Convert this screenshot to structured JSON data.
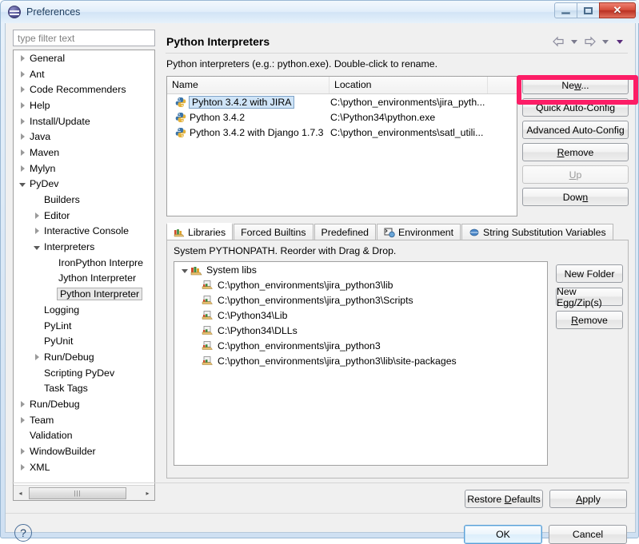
{
  "window": {
    "title": "Preferences",
    "icon": "preferences-icon",
    "controls": {
      "minimize": "–",
      "maximize": "□",
      "close": "✕"
    }
  },
  "sidebar": {
    "filter_placeholder": "type filter text",
    "items": [
      {
        "label": "General",
        "indent": 0,
        "twisty": "collapsed",
        "selected": false
      },
      {
        "label": "Ant",
        "indent": 0,
        "twisty": "collapsed",
        "selected": false
      },
      {
        "label": "Code Recommenders",
        "indent": 0,
        "twisty": "collapsed",
        "selected": false
      },
      {
        "label": "Help",
        "indent": 0,
        "twisty": "collapsed",
        "selected": false
      },
      {
        "label": "Install/Update",
        "indent": 0,
        "twisty": "collapsed",
        "selected": false
      },
      {
        "label": "Java",
        "indent": 0,
        "twisty": "collapsed",
        "selected": false
      },
      {
        "label": "Maven",
        "indent": 0,
        "twisty": "collapsed",
        "selected": false
      },
      {
        "label": "Mylyn",
        "indent": 0,
        "twisty": "collapsed",
        "selected": false
      },
      {
        "label": "PyDev",
        "indent": 0,
        "twisty": "expanded",
        "selected": false
      },
      {
        "label": "Builders",
        "indent": 1,
        "twisty": "none",
        "selected": false
      },
      {
        "label": "Editor",
        "indent": 1,
        "twisty": "collapsed",
        "selected": false
      },
      {
        "label": "Interactive Console",
        "indent": 1,
        "twisty": "collapsed",
        "selected": false
      },
      {
        "label": "Interpreters",
        "indent": 1,
        "twisty": "expanded",
        "selected": false
      },
      {
        "label": "IronPython Interpre",
        "indent": 2,
        "twisty": "none",
        "selected": false
      },
      {
        "label": "Jython Interpreter",
        "indent": 2,
        "twisty": "none",
        "selected": false
      },
      {
        "label": "Python Interpreter",
        "indent": 2,
        "twisty": "none",
        "selected": true
      },
      {
        "label": "Logging",
        "indent": 1,
        "twisty": "none",
        "selected": false
      },
      {
        "label": "PyLint",
        "indent": 1,
        "twisty": "none",
        "selected": false
      },
      {
        "label": "PyUnit",
        "indent": 1,
        "twisty": "none",
        "selected": false
      },
      {
        "label": "Run/Debug",
        "indent": 1,
        "twisty": "collapsed",
        "selected": false
      },
      {
        "label": "Scripting PyDev",
        "indent": 1,
        "twisty": "none",
        "selected": false
      },
      {
        "label": "Task Tags",
        "indent": 1,
        "twisty": "none",
        "selected": false
      },
      {
        "label": "Run/Debug",
        "indent": 0,
        "twisty": "collapsed",
        "selected": false
      },
      {
        "label": "Team",
        "indent": 0,
        "twisty": "collapsed",
        "selected": false
      },
      {
        "label": "Validation",
        "indent": 0,
        "twisty": "none",
        "selected": false
      },
      {
        "label": "WindowBuilder",
        "indent": 0,
        "twisty": "collapsed",
        "selected": false
      },
      {
        "label": "XML",
        "indent": 0,
        "twisty": "collapsed",
        "selected": false
      }
    ],
    "hscroll": {
      "left_arrow": "◂",
      "right_arrow": "▸",
      "grip": "|||"
    }
  },
  "main": {
    "page_title": "Python Interpreters",
    "description": "Python interpreters (e.g.: python.exe).  Double-click to rename.",
    "nav": {
      "back": "back-arrow",
      "back_menu": "chevron-down",
      "forward": "forward-arrow",
      "forward_menu": "chevron-down",
      "view_menu": "chevron-down"
    },
    "table": {
      "columns": [
        "Name",
        "Location",
        ""
      ],
      "rows": [
        {
          "name": "Pyhton 3.4.2 with JIRA",
          "location": "C:\\python_environments\\jira_pyth...",
          "selected": true
        },
        {
          "name": "Python 3.4.2",
          "location": "C:\\Python34\\python.exe",
          "selected": false
        },
        {
          "name": "Python 3.4.2 with Django 1.7.3",
          "location": "C:\\python_environments\\satl_utili...",
          "selected": false
        }
      ]
    },
    "side_buttons": [
      {
        "label": "New...",
        "mnemonic": "w",
        "disabled": false,
        "highlighted": true
      },
      {
        "label": "Quick Auto-Config",
        "mnemonic": "",
        "disabled": false,
        "highlighted": false
      },
      {
        "label": "Advanced Auto-Config",
        "mnemonic": "",
        "disabled": false,
        "highlighted": false
      },
      {
        "label": "Remove",
        "mnemonic": "R",
        "disabled": false,
        "highlighted": false
      },
      {
        "label": "Up",
        "mnemonic": "U",
        "disabled": true,
        "highlighted": false
      },
      {
        "label": "Down",
        "mnemonic": "n",
        "disabled": false,
        "highlighted": false
      }
    ],
    "tabs": [
      {
        "label": "Libraries",
        "icon": "libraries-icon",
        "active": true
      },
      {
        "label": "Forced Builtins",
        "icon": "none",
        "active": false
      },
      {
        "label": "Predefined",
        "icon": "none",
        "active": false
      },
      {
        "label": "Environment",
        "icon": "environment-icon",
        "active": false
      },
      {
        "label": "String Substitution Variables",
        "icon": "variables-icon",
        "active": false
      }
    ],
    "libraries": {
      "description": "System PYTHONPATH.  Reorder with Drag & Drop.",
      "root_label": "System libs",
      "paths": [
        "C:\\python_environments\\jira_python3\\lib",
        "C:\\python_environments\\jira_python3\\Scripts",
        "C:\\Python34\\Lib",
        "C:\\Python34\\DLLs",
        "C:\\python_environments\\jira_python3",
        "C:\\python_environments\\jira_python3\\lib\\site-packages"
      ],
      "buttons": [
        {
          "label": "New Folder",
          "mnemonic": ""
        },
        {
          "label": "New Egg/Zip(s)",
          "mnemonic": ""
        },
        {
          "label": "Remove",
          "mnemonic": "R"
        }
      ]
    }
  },
  "footer": {
    "restore_defaults": "Restore Defaults",
    "restore_mnemonic": "D",
    "apply": "Apply",
    "apply_mnemonic": "A",
    "help": "?",
    "ok": "OK",
    "cancel": "Cancel"
  },
  "colors": {
    "highlight_annotation": "#fc1d66",
    "selection_blue": "#cfe4f7",
    "title_text": "#1c3c5e",
    "close_button": "#c9402c"
  }
}
